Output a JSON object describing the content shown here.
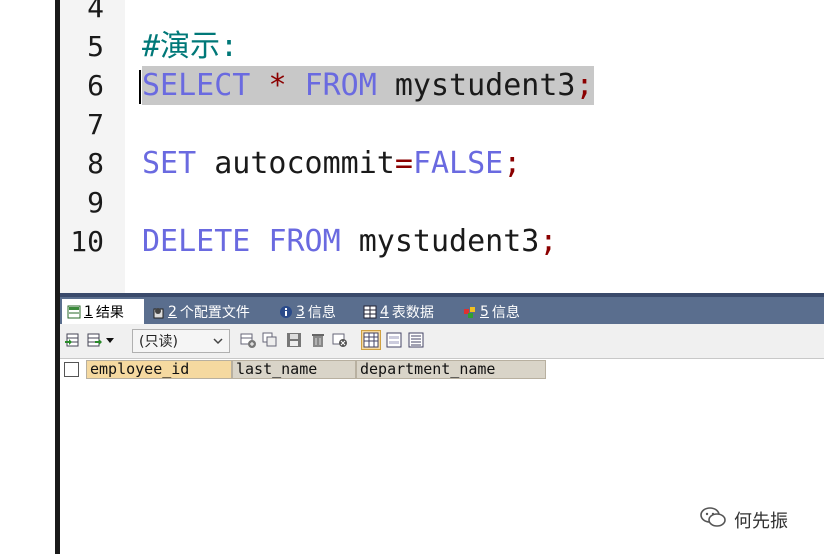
{
  "editor": {
    "line_numbers": [
      "4",
      "5",
      "6",
      "7",
      "8",
      "9",
      "10"
    ],
    "comment": "#演示:",
    "select_kw": "SELECT",
    "select_star": "*",
    "select_from": "FROM",
    "select_table": "mystudent3",
    "select_semi": ";",
    "set_kw": "SET",
    "set_var": "autocommit",
    "set_eq": "=",
    "set_val": "FALSE",
    "set_semi": ";",
    "delete_kw": "DELETE",
    "delete_from": "FROM",
    "delete_table": "mystudent3",
    "delete_semi": ";"
  },
  "tabs": [
    {
      "num": "1",
      "label": "结果",
      "icon": "result-grid-icon"
    },
    {
      "num": "2",
      "label": "个配置文件",
      "icon": "profile-icon"
    },
    {
      "num": "3",
      "label": "信息",
      "icon": "info-icon"
    },
    {
      "num": "4",
      "label": "表数据",
      "icon": "table-data-icon"
    },
    {
      "num": "5",
      "label": "信息",
      "icon": "info-icon"
    }
  ],
  "toolbar": {
    "readonly_label": "(只读)"
  },
  "grid": {
    "columns": [
      "employee_id",
      "last_name",
      "department_name"
    ]
  },
  "watermark": {
    "text": "何先振"
  },
  "colors": {
    "keyword": "#6a6ae0",
    "operator": "#8b0000",
    "comment": "#007878",
    "tabbar": "#5a6e8e"
  }
}
